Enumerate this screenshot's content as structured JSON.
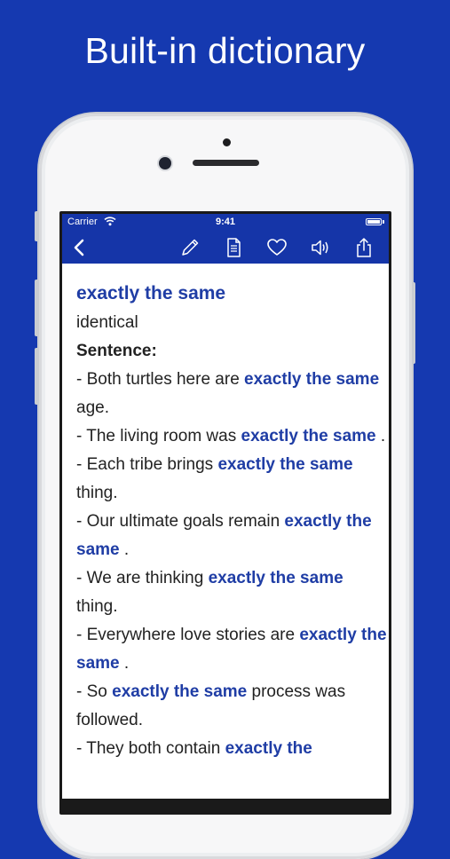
{
  "headline": "Built-in dictionary",
  "status": {
    "carrier": "Carrier",
    "time": "9:41"
  },
  "nav": {
    "icons": [
      "back-icon",
      "pencil-icon",
      "document-icon",
      "heart-icon",
      "speaker-icon",
      "share-icon"
    ]
  },
  "entry": {
    "word": "exactly the same",
    "definition": "identical",
    "sentence_label": "Sentence:",
    "sentences": [
      {
        "pre": "- Both turtles here are ",
        "hl": "exactly the same",
        "post": " age."
      },
      {
        "pre": "- The living room was ",
        "hl": "exactly the same",
        "post": " ."
      },
      {
        "pre": "- Each tribe brings ",
        "hl": "exactly the same",
        "post": " thing."
      },
      {
        "pre": "- Our ultimate goals remain ",
        "hl": "exactly the same",
        "post": " ."
      },
      {
        "pre": "- We are thinking ",
        "hl": "exactly the same",
        "post": " thing."
      },
      {
        "pre": "- Everywhere love stories are ",
        "hl": "exactly the same",
        "post": " ."
      },
      {
        "pre": "- So ",
        "hl": "exactly the same",
        "post": " process was followed."
      },
      {
        "pre": "- They both contain ",
        "hl": "exactly the",
        "post": ""
      }
    ]
  },
  "colors": {
    "background": "#1539b0",
    "navbar": "#1535a8",
    "highlight": "#1f3da5"
  }
}
